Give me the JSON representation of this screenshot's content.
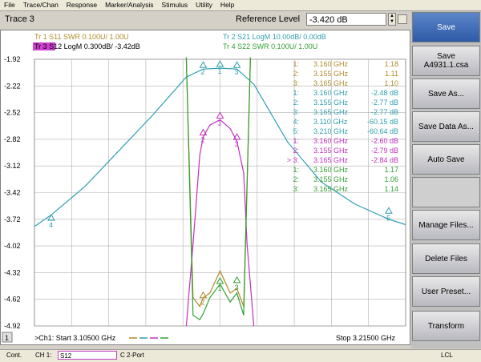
{
  "menu": [
    "File",
    "Trace/Chan",
    "Response",
    "Marker/Analysis",
    "Stimulus",
    "Utility",
    "Help"
  ],
  "trace_title": "Trace 3",
  "reference": {
    "label": "Reference Level",
    "value": "-3.420 dB"
  },
  "legend": [
    {
      "text": "Tr 1  S11 SWR 0.100U/  1.00U",
      "color": "#b08a28"
    },
    {
      "text": "Tr 2  S21 LogM 10.00dB/  0.00dB",
      "color": "#2f9fb0"
    },
    {
      "text": "Tr 3  S12 LogM 0.300dB/  -3.42dB",
      "color": "#c030c0"
    },
    {
      "text": "Tr 4  S22 SWR 0.100U/  1.00U",
      "color": "#30a030"
    }
  ],
  "y_ticks": [
    "-1.92",
    "-2.22",
    "-2.52",
    "-2.82",
    "-3.12",
    "-3.42",
    "-3.72",
    "-4.02",
    "-4.32",
    "-4.62",
    "-4.92"
  ],
  "markers_table": [
    {
      "id": "1:",
      "freq": "3.160 GHz",
      "val": "1.18",
      "color": "#b08a28"
    },
    {
      "id": "2:",
      "freq": "3.155 GHz",
      "val": "1.11",
      "color": "#b08a28"
    },
    {
      "id": "3:",
      "freq": "3.165 GHz",
      "val": "1.10",
      "color": "#b08a28"
    },
    {
      "id": "1:",
      "freq": "3.160 GHz",
      "val": "-2.48 dB",
      "color": "#2f9fb0"
    },
    {
      "id": "2:",
      "freq": "3.155 GHz",
      "val": "-2.77 dB",
      "color": "#2f9fb0"
    },
    {
      "id": "3:",
      "freq": "3.165 GHz",
      "val": "-2.77 dB",
      "color": "#2f9fb0"
    },
    {
      "id": "4:",
      "freq": "3.110 GHz",
      "val": "-60.15 dB",
      "color": "#2f9fb0"
    },
    {
      "id": "5:",
      "freq": "3.210 GHz",
      "val": "-60.64 dB",
      "color": "#2f9fb0"
    },
    {
      "id": "1:",
      "freq": "3.160 GHz",
      "val": "-2.60 dB",
      "color": "#c030c0"
    },
    {
      "id": "2:",
      "freq": "3.155 GHz",
      "val": "-2.79 dB",
      "color": "#c030c0"
    },
    {
      "id": "> 3:",
      "freq": "3.165 GHz",
      "val": "-2.84 dB",
      "color": "#c030c0"
    },
    {
      "id": "1:",
      "freq": "3.160 GHz",
      "val": "1.17",
      "color": "#30a030"
    },
    {
      "id": "2:",
      "freq": "3.155 GHz",
      "val": "1.06",
      "color": "#30a030"
    },
    {
      "id": "3:",
      "freq": "3.165 GHz",
      "val": "1.14",
      "color": "#30a030"
    }
  ],
  "channel": {
    "number": "1",
    "start": ">Ch1: Start  3.10500 GHz",
    "stop": "Stop  3.21500 GHz"
  },
  "softkeys": [
    {
      "label": "Save",
      "sub": ""
    },
    {
      "label": "Save",
      "sub": "A4931.1.csa"
    },
    {
      "label": "Save As...",
      "sub": ""
    },
    {
      "label": "Save Data As...",
      "sub": ""
    },
    {
      "label": "Auto Save",
      "sub": ""
    },
    {
      "label": "",
      "sub": ""
    },
    {
      "label": "Manage Files...",
      "sub": ""
    },
    {
      "label": "Delete Files",
      "sub": ""
    },
    {
      "label": "User Preset...",
      "sub": ""
    },
    {
      "label": "Transform",
      "sub": ""
    }
  ],
  "status": {
    "cont": "Cont.",
    "ch": "CH 1:",
    "param": "S12",
    "port": "C  2-Port",
    "lcl": "LCL"
  },
  "chart_data": {
    "type": "line",
    "x_range_ghz": [
      3.105,
      3.215
    ],
    "ylim_trace3_db": [
      -4.92,
      -1.92
    ],
    "series": [
      {
        "name": "S11 SWR",
        "color": "#b08a28",
        "x": [
          3.15,
          3.152,
          3.154,
          3.155,
          3.157,
          3.16,
          3.163,
          3.165,
          3.167,
          3.169
        ],
        "y": [
          -1.9,
          -4.6,
          -4.7,
          -4.6,
          -4.55,
          -4.3,
          -4.55,
          -4.5,
          -4.7,
          -1.9
        ]
      },
      {
        "name": "S21 LogM",
        "color": "#2f9fb0",
        "x": [
          3.105,
          3.11,
          3.12,
          3.13,
          3.14,
          3.15,
          3.155,
          3.16,
          3.165,
          3.17,
          3.18,
          3.19,
          3.2,
          3.21,
          3.215
        ],
        "y": [
          -3.8,
          -3.67,
          -3.35,
          -2.95,
          -2.55,
          -2.12,
          -2.03,
          -2.02,
          -2.03,
          -2.2,
          -2.85,
          -3.3,
          -3.55,
          -3.72,
          -3.78
        ]
      },
      {
        "name": "S12 LogM",
        "color": "#c030c0",
        "x": [
          3.15,
          3.152,
          3.154,
          3.155,
          3.157,
          3.16,
          3.163,
          3.165,
          3.167,
          3.168,
          3.17
        ],
        "y": [
          -4.92,
          -4.0,
          -3.0,
          -2.79,
          -2.66,
          -2.6,
          -2.7,
          -2.84,
          -3.2,
          -4.0,
          -4.92
        ]
      },
      {
        "name": "S22 SWR",
        "color": "#30a030",
        "x": [
          3.15,
          3.152,
          3.154,
          3.155,
          3.157,
          3.16,
          3.163,
          3.165,
          3.167,
          3.169
        ],
        "y": [
          -1.9,
          -4.8,
          -4.85,
          -4.78,
          -4.6,
          -4.45,
          -4.65,
          -4.55,
          -4.8,
          -1.9
        ]
      }
    ]
  }
}
